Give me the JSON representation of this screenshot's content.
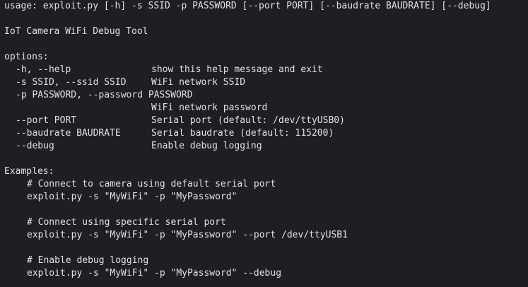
{
  "terminal": {
    "usage": "usage: exploit.py [-h] -s SSID -p PASSWORD [--port PORT] [--baudrate BAUDRATE] [--debug]",
    "description": "IoT Camera WiFi Debug Tool",
    "options_header": "options:",
    "options": [
      {
        "flag": "-h, --help",
        "help": "show this help message and exit"
      },
      {
        "flag": "-s SSID, --ssid SSID",
        "help": "WiFi network SSID"
      },
      {
        "flag": "-p PASSWORD, --password PASSWORD",
        "help": ""
      },
      {
        "flag": "",
        "help": "WiFi network password"
      },
      {
        "flag": "--port PORT",
        "help": "Serial port (default: /dev/ttyUSB0)"
      },
      {
        "flag": "--baudrate BAUDRATE",
        "help": "Serial baudrate (default: 115200)"
      },
      {
        "flag": "--debug",
        "help": "Enable debug logging"
      }
    ],
    "examples_header": "Examples:",
    "examples": [
      {
        "comment": "# Connect to camera using default serial port",
        "command": "exploit.py -s \"MyWiFi\" -p \"MyPassword\""
      },
      {
        "comment": "# Connect using specific serial port",
        "command": "exploit.py -s \"MyWiFi\" -p \"MyPassword\" --port /dev/ttyUSB1"
      },
      {
        "comment": "# Enable debug logging",
        "command": "exploit.py -s \"MyWiFi\" -p \"MyPassword\" --debug"
      }
    ],
    "colors": {
      "background": "#1e1f22",
      "text": "#dfe1e5"
    }
  }
}
